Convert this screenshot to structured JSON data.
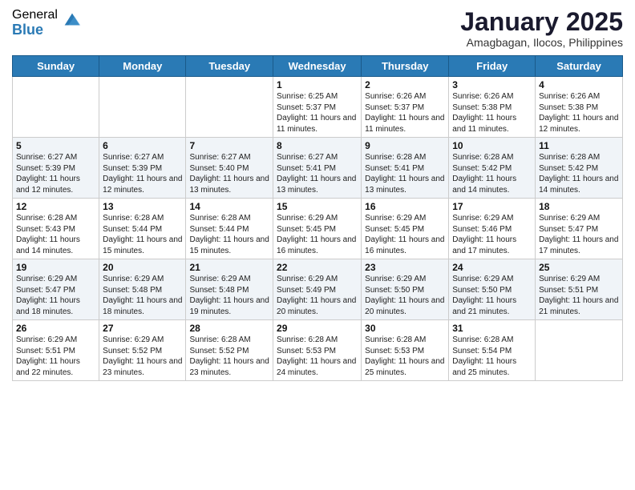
{
  "logo": {
    "general": "General",
    "blue": "Blue"
  },
  "title": "January 2025",
  "subtitle": "Amagbagan, Ilocos, Philippines",
  "days_of_week": [
    "Sunday",
    "Monday",
    "Tuesday",
    "Wednesday",
    "Thursday",
    "Friday",
    "Saturday"
  ],
  "weeks": [
    [
      {
        "day": "",
        "sunrise": "",
        "sunset": "",
        "daylight": ""
      },
      {
        "day": "",
        "sunrise": "",
        "sunset": "",
        "daylight": ""
      },
      {
        "day": "",
        "sunrise": "",
        "sunset": "",
        "daylight": ""
      },
      {
        "day": "1",
        "sunrise": "Sunrise: 6:25 AM",
        "sunset": "Sunset: 5:37 PM",
        "daylight": "Daylight: 11 hours and 11 minutes."
      },
      {
        "day": "2",
        "sunrise": "Sunrise: 6:26 AM",
        "sunset": "Sunset: 5:37 PM",
        "daylight": "Daylight: 11 hours and 11 minutes."
      },
      {
        "day": "3",
        "sunrise": "Sunrise: 6:26 AM",
        "sunset": "Sunset: 5:38 PM",
        "daylight": "Daylight: 11 hours and 11 minutes."
      },
      {
        "day": "4",
        "sunrise": "Sunrise: 6:26 AM",
        "sunset": "Sunset: 5:38 PM",
        "daylight": "Daylight: 11 hours and 12 minutes."
      }
    ],
    [
      {
        "day": "5",
        "sunrise": "Sunrise: 6:27 AM",
        "sunset": "Sunset: 5:39 PM",
        "daylight": "Daylight: 11 hours and 12 minutes."
      },
      {
        "day": "6",
        "sunrise": "Sunrise: 6:27 AM",
        "sunset": "Sunset: 5:39 PM",
        "daylight": "Daylight: 11 hours and 12 minutes."
      },
      {
        "day": "7",
        "sunrise": "Sunrise: 6:27 AM",
        "sunset": "Sunset: 5:40 PM",
        "daylight": "Daylight: 11 hours and 13 minutes."
      },
      {
        "day": "8",
        "sunrise": "Sunrise: 6:27 AM",
        "sunset": "Sunset: 5:41 PM",
        "daylight": "Daylight: 11 hours and 13 minutes."
      },
      {
        "day": "9",
        "sunrise": "Sunrise: 6:28 AM",
        "sunset": "Sunset: 5:41 PM",
        "daylight": "Daylight: 11 hours and 13 minutes."
      },
      {
        "day": "10",
        "sunrise": "Sunrise: 6:28 AM",
        "sunset": "Sunset: 5:42 PM",
        "daylight": "Daylight: 11 hours and 14 minutes."
      },
      {
        "day": "11",
        "sunrise": "Sunrise: 6:28 AM",
        "sunset": "Sunset: 5:42 PM",
        "daylight": "Daylight: 11 hours and 14 minutes."
      }
    ],
    [
      {
        "day": "12",
        "sunrise": "Sunrise: 6:28 AM",
        "sunset": "Sunset: 5:43 PM",
        "daylight": "Daylight: 11 hours and 14 minutes."
      },
      {
        "day": "13",
        "sunrise": "Sunrise: 6:28 AM",
        "sunset": "Sunset: 5:44 PM",
        "daylight": "Daylight: 11 hours and 15 minutes."
      },
      {
        "day": "14",
        "sunrise": "Sunrise: 6:28 AM",
        "sunset": "Sunset: 5:44 PM",
        "daylight": "Daylight: 11 hours and 15 minutes."
      },
      {
        "day": "15",
        "sunrise": "Sunrise: 6:29 AM",
        "sunset": "Sunset: 5:45 PM",
        "daylight": "Daylight: 11 hours and 16 minutes."
      },
      {
        "day": "16",
        "sunrise": "Sunrise: 6:29 AM",
        "sunset": "Sunset: 5:45 PM",
        "daylight": "Daylight: 11 hours and 16 minutes."
      },
      {
        "day": "17",
        "sunrise": "Sunrise: 6:29 AM",
        "sunset": "Sunset: 5:46 PM",
        "daylight": "Daylight: 11 hours and 17 minutes."
      },
      {
        "day": "18",
        "sunrise": "Sunrise: 6:29 AM",
        "sunset": "Sunset: 5:47 PM",
        "daylight": "Daylight: 11 hours and 17 minutes."
      }
    ],
    [
      {
        "day": "19",
        "sunrise": "Sunrise: 6:29 AM",
        "sunset": "Sunset: 5:47 PM",
        "daylight": "Daylight: 11 hours and 18 minutes."
      },
      {
        "day": "20",
        "sunrise": "Sunrise: 6:29 AM",
        "sunset": "Sunset: 5:48 PM",
        "daylight": "Daylight: 11 hours and 18 minutes."
      },
      {
        "day": "21",
        "sunrise": "Sunrise: 6:29 AM",
        "sunset": "Sunset: 5:48 PM",
        "daylight": "Daylight: 11 hours and 19 minutes."
      },
      {
        "day": "22",
        "sunrise": "Sunrise: 6:29 AM",
        "sunset": "Sunset: 5:49 PM",
        "daylight": "Daylight: 11 hours and 20 minutes."
      },
      {
        "day": "23",
        "sunrise": "Sunrise: 6:29 AM",
        "sunset": "Sunset: 5:50 PM",
        "daylight": "Daylight: 11 hours and 20 minutes."
      },
      {
        "day": "24",
        "sunrise": "Sunrise: 6:29 AM",
        "sunset": "Sunset: 5:50 PM",
        "daylight": "Daylight: 11 hours and 21 minutes."
      },
      {
        "day": "25",
        "sunrise": "Sunrise: 6:29 AM",
        "sunset": "Sunset: 5:51 PM",
        "daylight": "Daylight: 11 hours and 21 minutes."
      }
    ],
    [
      {
        "day": "26",
        "sunrise": "Sunrise: 6:29 AM",
        "sunset": "Sunset: 5:51 PM",
        "daylight": "Daylight: 11 hours and 22 minutes."
      },
      {
        "day": "27",
        "sunrise": "Sunrise: 6:29 AM",
        "sunset": "Sunset: 5:52 PM",
        "daylight": "Daylight: 11 hours and 23 minutes."
      },
      {
        "day": "28",
        "sunrise": "Sunrise: 6:28 AM",
        "sunset": "Sunset: 5:52 PM",
        "daylight": "Daylight: 11 hours and 23 minutes."
      },
      {
        "day": "29",
        "sunrise": "Sunrise: 6:28 AM",
        "sunset": "Sunset: 5:53 PM",
        "daylight": "Daylight: 11 hours and 24 minutes."
      },
      {
        "day": "30",
        "sunrise": "Sunrise: 6:28 AM",
        "sunset": "Sunset: 5:53 PM",
        "daylight": "Daylight: 11 hours and 25 minutes."
      },
      {
        "day": "31",
        "sunrise": "Sunrise: 6:28 AM",
        "sunset": "Sunset: 5:54 PM",
        "daylight": "Daylight: 11 hours and 25 minutes."
      },
      {
        "day": "",
        "sunrise": "",
        "sunset": "",
        "daylight": ""
      }
    ]
  ]
}
